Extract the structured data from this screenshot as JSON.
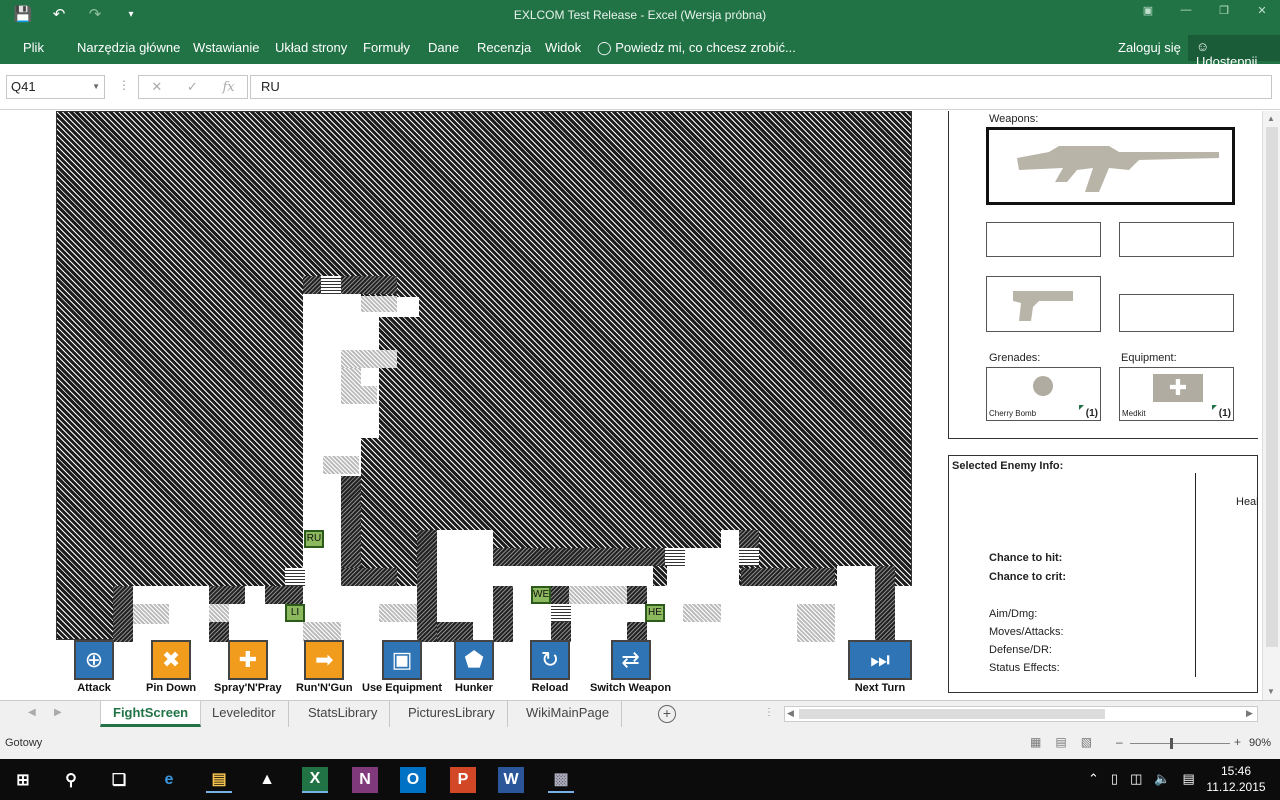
{
  "window": {
    "title": "EXLCOM Test Release - Excel (Wersja próbna)"
  },
  "ribbon": {
    "tabs": [
      "Plik",
      "Narzędzia główne",
      "Wstawianie",
      "Układ strony",
      "Formuły",
      "Dane",
      "Recenzja",
      "Widok"
    ],
    "tell_me": "Powiedz mi, co chcesz zrobić...",
    "sign_in": "Zaloguj się",
    "share": "Udostępnij"
  },
  "formula_bar": {
    "name_box": "Q41",
    "formula": "RU",
    "fx": "fx"
  },
  "map": {
    "units": [
      {
        "label": "RU",
        "color": "#8cb85e"
      },
      {
        "label": "LI",
        "color": "#8cb85e"
      },
      {
        "label": "WE",
        "color": "#8cb85e"
      },
      {
        "label": "HE",
        "color": "#8cb85e"
      }
    ]
  },
  "actions": [
    {
      "label": "Attack",
      "icon": "crosshair-icon",
      "color": "#2f74b5"
    },
    {
      "label": "Pin Down",
      "icon": "pin-down-icon",
      "color": "#f29c1e"
    },
    {
      "label": "Spray'N'Pray",
      "icon": "spray-icon",
      "color": "#f29c1e"
    },
    {
      "label": "Run'N'Gun",
      "icon": "run-arrow-icon",
      "color": "#f29c1e"
    },
    {
      "label": "Use Equipment",
      "icon": "medkit-icon",
      "color": "#2f74b5"
    },
    {
      "label": "Hunker",
      "icon": "shield-icon",
      "color": "#2f74b5"
    },
    {
      "label": "Reload",
      "icon": "reload-icon",
      "color": "#2f74b5"
    },
    {
      "label": "Switch Weapon",
      "icon": "switch-icon",
      "color": "#2f74b5"
    },
    {
      "label": "Next Turn",
      "icon": "next-turn-icon",
      "color": "#2f74b5"
    }
  ],
  "loadout": {
    "weapons_label": "Weapons:",
    "grenades_label": "Grenades:",
    "equipment_label": "Equipment:",
    "grenade": {
      "name": "Cherry Bomb",
      "count": "(1)"
    },
    "equipment": {
      "name": "Medkit",
      "count": "(1)"
    }
  },
  "enemy_info": {
    "title": "Selected Enemy Info:",
    "health_label": "Heal",
    "chance_hit": "Chance to hit:",
    "chance_crit": "Chance to crit:",
    "aim_dmg": "Aim/Dmg:",
    "moves": "Moves/Attacks:",
    "defense": "Defense/DR:",
    "status": "Status Effects:"
  },
  "sheets": {
    "tabs": [
      "FightScreen",
      "Leveleditor",
      "StatsLibrary",
      "PicturesLibrary",
      "WikiMainPage"
    ],
    "active": "FightScreen"
  },
  "status_bar": {
    "ready": "Gotowy",
    "zoom": "90%",
    "zoom_fraction": 0.4
  },
  "taskbar": {
    "time": "15:46",
    "date": "11.12.2015"
  }
}
